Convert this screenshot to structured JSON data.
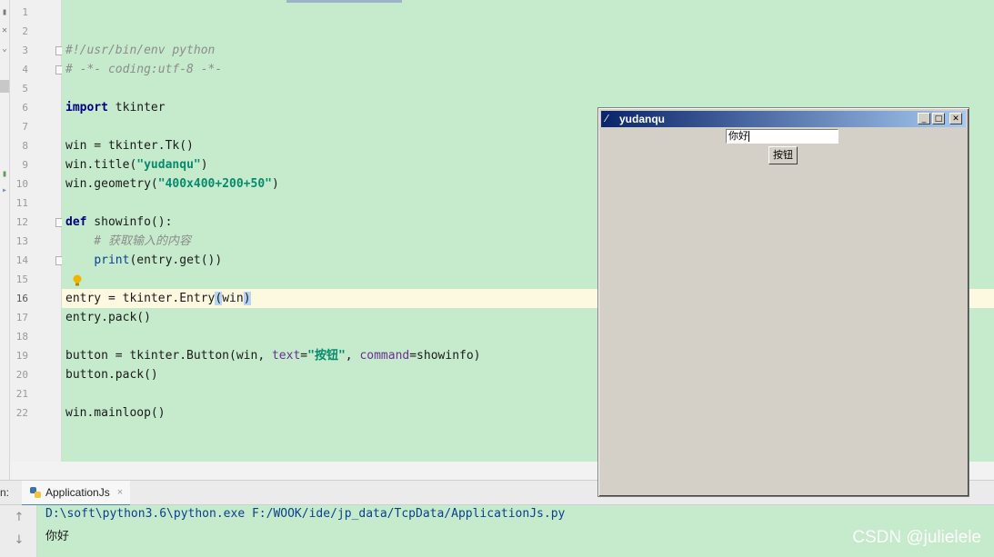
{
  "editor": {
    "line_numbers": [
      "1",
      "2",
      "3",
      "4",
      "5",
      "6",
      "7",
      "8",
      "9",
      "10",
      "11",
      "12",
      "13",
      "14",
      "15",
      "16",
      "17",
      "18",
      "19",
      "20",
      "21",
      "22"
    ],
    "code": {
      "l3": "#!/usr/bin/env python",
      "l4": "# -*- coding:utf-8 -*-",
      "l6_kw": "import",
      "l6_rest": " tkinter",
      "l8": "win = tkinter.Tk()",
      "l9_a": "win.title(",
      "l9_str": "\"yudanqu\"",
      "l9_b": ")",
      "l10_a": "win.geometry(",
      "l10_str": "\"400x400+200+50\"",
      "l10_b": ")",
      "l12_kw": "def",
      "l12_rest": " showinfo():",
      "l13": "    # 获取输入的内容",
      "l14_indent": "    ",
      "l14_fn": "print",
      "l14_rest": "(entry.get())",
      "l16_a": "entry = tkinter.Entry",
      "l16_paren": "(",
      "l16_arg": "win",
      "l16_close": ")",
      "l17": "entry.pack()",
      "l19_a": "button = tkinter.Button(win, ",
      "l19_kw1": "text",
      "l19_eq": "=",
      "l19_str": "\"按钮\"",
      "l19_b": ", ",
      "l19_kw2": "command",
      "l19_c": "=showinfo)",
      "l20": "button.pack()",
      "l22": "win.mainloop()"
    }
  },
  "run_panel": {
    "label": "n:",
    "tab_label": "ApplicationJs",
    "close_glyph": "×",
    "console_line1": "D:\\soft\\python3.6\\python.exe F:/WOOK/ide/jp_data/TcpData/ApplicationJs.py",
    "console_line2": "你好",
    "up_arrow": "↑",
    "down_arrow": "↓"
  },
  "tk_window": {
    "title": "yudanqu",
    "feather": "⁄",
    "entry_value": "你好",
    "button_label": "按钮",
    "minimize_glyph": "_",
    "maximize_glyph": "□",
    "close_glyph": "✕"
  },
  "watermark": "CSDN @julielele",
  "colors": {
    "editor_bg": "#c6ebcc",
    "current_line": "#fdf8e0",
    "keyword": "#000080",
    "string": "#068a6e",
    "titlebar_start": "#0a246a",
    "titlebar_end": "#a6caf0"
  }
}
